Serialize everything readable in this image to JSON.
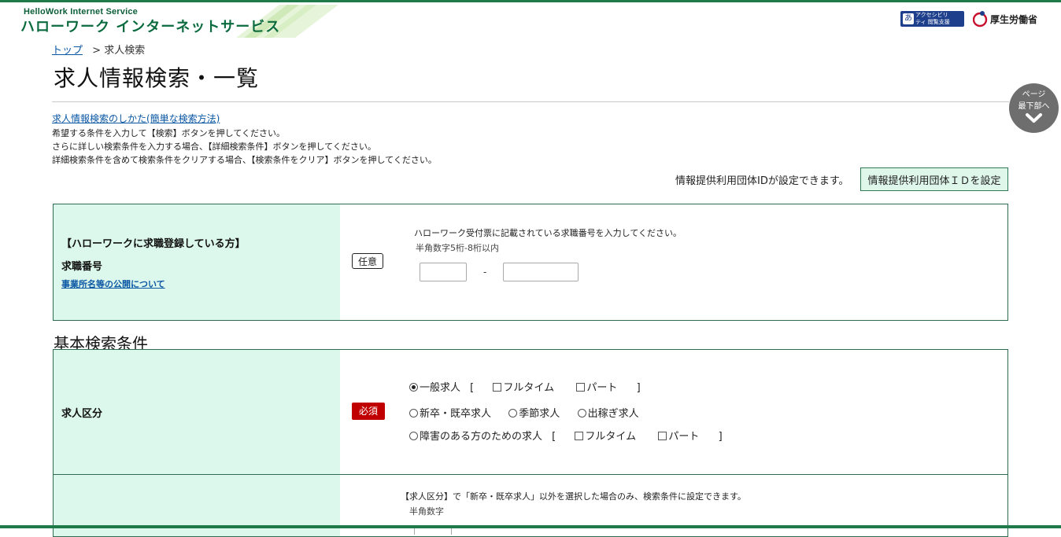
{
  "header": {
    "logo_en": "HelloWork Internet Service",
    "logo_jp": "ハローワーク インターネットサービス",
    "a11y_glyph": "あ",
    "a11y_text": "アクセシビリティ 閲覧支援ツール",
    "ministry": "厚生労働省",
    "brand_color": "#1f7a4a"
  },
  "breadcrumb": {
    "home": "トップ",
    "separator": ">",
    "current": "求人検索"
  },
  "page": {
    "title": "求人情報検索・一覧"
  },
  "help": {
    "howto_link": "求人情報検索のしかた(簡単な検索方法)",
    "lines": [
      "希望する条件を入力して【検索】ボタンを押してください。",
      "さらに詳しい検索条件を入力する場合、【詳細検索条件】ボタンを押してください。",
      "詳細検索条件を含めて検索条件をクリアする場合、【検索条件をクリア】ボタンを押してください。"
    ]
  },
  "scroll_bottom": {
    "line1": "ページ",
    "line2": "最下部へ"
  },
  "org_id": {
    "note": "情報提供利用団体IDが設定できます。",
    "button": "情報提供利用団体ＩＤを設定"
  },
  "registration": {
    "heading": "【ハローワークに求職登録している方】",
    "label": "求職番号",
    "link": "事業所名等の公開について",
    "badge": "任意",
    "note": "ハローワーク受付票に記載されている求職番号を入力してください。",
    "sub_note": "半角数字5桁-8桁以内",
    "field1_value": "",
    "field2_value": "",
    "dash": "-"
  },
  "basic": {
    "heading": "基本検索条件",
    "job_type": {
      "label": "求人区分",
      "badge": "必須",
      "general": "一般求人",
      "bracket_open": "[",
      "bracket_close": "]",
      "fulltime": "フルタイム",
      "parttime": "パート",
      "newgrad": "新卒・既卒求人",
      "seasonal": "季節求人",
      "migrant": "出稼ぎ求人",
      "disabled": "障害のある方のための求人"
    },
    "next_row": {
      "note": "【求人区分】で「新卒・既卒求人」以外を選択した場合のみ、検索条件に設定できます。",
      "sub_note": "半角数字"
    }
  }
}
